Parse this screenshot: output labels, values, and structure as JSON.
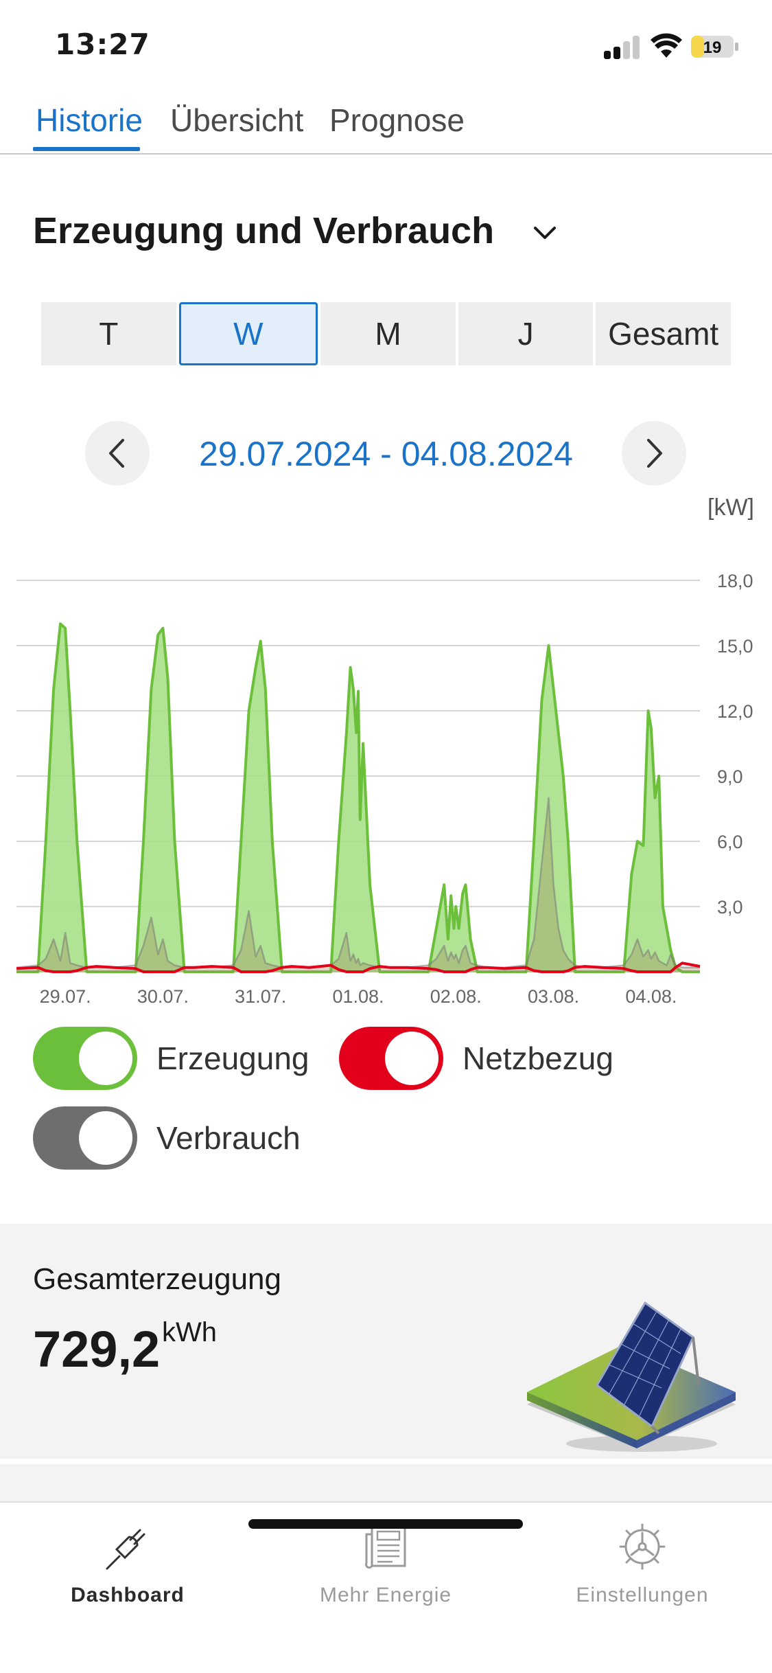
{
  "status_bar": {
    "time": "13:27",
    "battery_level": "19",
    "battery_color": "#f6d64a"
  },
  "tabs": [
    {
      "label": "Historie",
      "active": true
    },
    {
      "label": "Übersicht",
      "active": false
    },
    {
      "label": "Prognose",
      "active": false
    }
  ],
  "section": {
    "title": "Erzeugung und Verbrauch"
  },
  "period_selector": [
    {
      "label": "T",
      "active": false
    },
    {
      "label": "W",
      "active": true
    },
    {
      "label": "M",
      "active": false
    },
    {
      "label": "J",
      "active": false
    },
    {
      "label": "Gesamt",
      "active": false
    }
  ],
  "date_nav": {
    "range": "29.07.2024 - 04.08.2024"
  },
  "chart_unit": "[kW]",
  "chart_data": {
    "type": "area",
    "x_tick_labels": [
      "29.07.",
      "30.07.",
      "31.07.",
      "01.08.",
      "02.08.",
      "03.08.",
      "04.08."
    ],
    "y_tick_labels": [
      "18,0",
      "15,0",
      "12,0",
      "9,0",
      "6,0",
      "3,0"
    ],
    "ylim": [
      0,
      18
    ],
    "y_ticks": [
      18,
      15,
      12,
      9,
      6,
      3
    ],
    "grid": true,
    "x": [
      0,
      0.22,
      0.3,
      0.38,
      0.45,
      0.5,
      0.55,
      0.62,
      0.72,
      0.82,
      1,
      1.22,
      1.3,
      1.38,
      1.45,
      1.5,
      1.55,
      1.62,
      1.72,
      1.82,
      2,
      2.22,
      2.3,
      2.38,
      2.45,
      2.5,
      2.55,
      2.62,
      2.72,
      2.82,
      3,
      3.22,
      3.3,
      3.38,
      3.42,
      3.45,
      3.48,
      3.5,
      3.52,
      3.55,
      3.62,
      3.72,
      3.82,
      4,
      4.22,
      4.3,
      4.38,
      4.42,
      4.45,
      4.48,
      4.5,
      4.53,
      4.57,
      4.6,
      4.65,
      4.72,
      4.82,
      5,
      5.22,
      5.3,
      5.38,
      5.45,
      5.5,
      5.55,
      5.6,
      5.65,
      5.72,
      5.82,
      6,
      6.22,
      6.3,
      6.36,
      6.42,
      6.47,
      6.5,
      6.54,
      6.58,
      6.62,
      6.66,
      6.7,
      6.75,
      6.82,
      7
    ],
    "series": [
      {
        "name": "Erzeugung",
        "color": "#6cbf3a",
        "fill": "#a8e08a",
        "values": [
          0,
          0,
          6,
          13,
          16,
          15.8,
          12,
          6,
          0,
          0,
          0,
          0,
          6,
          13,
          15.5,
          15.8,
          13.5,
          6,
          0,
          0,
          0,
          0,
          6,
          12,
          14,
          15.2,
          13,
          6,
          0,
          0,
          0,
          0,
          6,
          11,
          14,
          13,
          11,
          12.9,
          7,
          10.5,
          4,
          0,
          0,
          0,
          0,
          2,
          4,
          1.5,
          3.5,
          2,
          3,
          2,
          3.6,
          4,
          1.5,
          0,
          0,
          0,
          0,
          6,
          12.5,
          15,
          13,
          11,
          9,
          6,
          0,
          0,
          0,
          0,
          4.5,
          6,
          5.8,
          12,
          11.2,
          8,
          9,
          3,
          2,
          1,
          0.2,
          0,
          0
        ]
      },
      {
        "name": "Verbrauch",
        "color": "#7a7a7a",
        "values": [
          0.2,
          0.3,
          0.6,
          1.5,
          0.5,
          1.8,
          0.4,
          0.3,
          0.2,
          0.2,
          0.2,
          0.3,
          1.2,
          2.5,
          0.8,
          1.5,
          0.5,
          0.3,
          0.2,
          0.2,
          0.2,
          0.3,
          1,
          2.8,
          0.7,
          1.2,
          0.4,
          0.3,
          0.2,
          0.2,
          0.2,
          0.3,
          0.6,
          1.8,
          0.5,
          0.8,
          0.4,
          0.6,
          0.3,
          0.4,
          0.3,
          0.2,
          0.2,
          0.2,
          0.3,
          0.6,
          1.2,
          0.5,
          0.9,
          0.6,
          0.8,
          0.4,
          1,
          1.2,
          0.4,
          0.3,
          0.2,
          0.2,
          0.3,
          1.5,
          5,
          8,
          4,
          2,
          1,
          0.6,
          0.3,
          0.2,
          0.2,
          0.3,
          0.8,
          1.5,
          0.7,
          1,
          0.6,
          0.9,
          0.5,
          0.4,
          0.3,
          0.8,
          0.3,
          0.2,
          0.2
        ]
      },
      {
        "name": "Netzbezug",
        "color": "#e2001a",
        "values": [
          0.15,
          0.2,
          0.05,
          0,
          0,
          0,
          0,
          0.05,
          0.2,
          0.25,
          0.2,
          0.15,
          0,
          0,
          0,
          0,
          0,
          0,
          0.2,
          0.2,
          0.25,
          0.2,
          0,
          0,
          0,
          0,
          0,
          0.05,
          0.2,
          0.25,
          0.2,
          0.3,
          0.1,
          0,
          0,
          0,
          0,
          0,
          0,
          0,
          0.15,
          0.25,
          0.2,
          0.2,
          0.15,
          0.1,
          0,
          0,
          0,
          0,
          0,
          0,
          0,
          0,
          0.1,
          0.2,
          0.2,
          0.15,
          0.2,
          0.05,
          0,
          0,
          0,
          0,
          0,
          0.05,
          0.2,
          0.25,
          0.2,
          0.15,
          0.05,
          0,
          0,
          0,
          0,
          0,
          0,
          0,
          0,
          0,
          0.2,
          0.4,
          0.25
        ]
      }
    ]
  },
  "legend": [
    {
      "label": "Erzeugung",
      "color": "#6cbf3a",
      "on": true
    },
    {
      "label": "Netzbezug",
      "color": "#e2001a",
      "on": true
    },
    {
      "label": "Verbrauch",
      "color": "#6e6e6e",
      "on": true
    }
  ],
  "summary": {
    "title": "Gesamterzeugung",
    "value": "729,2",
    "unit": "kWh"
  },
  "bottom_nav": [
    {
      "label": "Dashboard",
      "icon": "plug-icon",
      "active": true
    },
    {
      "label": "Mehr Energie",
      "icon": "newspaper-icon",
      "active": false
    },
    {
      "label": "Einstellungen",
      "icon": "gear-icon",
      "active": false
    }
  ]
}
